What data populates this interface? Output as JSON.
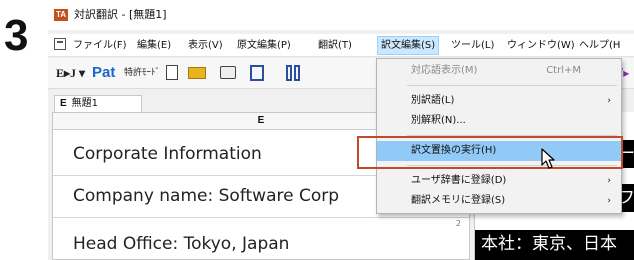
{
  "step_number": "3",
  "window": {
    "app_icon_text": "TA",
    "title": "対訳翻訳 - [無題1]"
  },
  "menubar": {
    "items": [
      "ファイル(F)",
      "編集(E)",
      "表示(V)",
      "原文編集(P)",
      "翻訳(T)",
      "訳文編集(S)",
      "ツール(L)",
      "ウィンドウ(W)",
      "ヘルプ(H"
    ]
  },
  "toolbar": {
    "ej_label": "E▸J ▾",
    "patent_label": "Pat",
    "patent_mode": "特許ﾓｰﾄﾞ"
  },
  "doc_tab": {
    "prefix": "E",
    "name": "無題1"
  },
  "left_pane": {
    "column_header": "E",
    "rows": [
      "Corporate Information",
      "Company name: Software Corp",
      "Head Office: Tokyo, Japan"
    ],
    "row_number": "2"
  },
  "right_pane": {
    "rows": [
      "メー",
      "ソフ",
      "本社：東京、日本"
    ]
  },
  "dropdown": {
    "items": [
      {
        "label": "対応語表示(M)",
        "shortcut": "Ctrl+M",
        "disabled": true
      },
      {
        "label": "別訳語(L)",
        "submenu": true
      },
      {
        "label": "別解釈(N)..."
      },
      {
        "label": "訳文置換の実行(H)",
        "highlighted": true
      },
      {
        "label": "ユーザ辞書に登録(D)",
        "submenu": true
      },
      {
        "label": "翻訳メモリに登録(S)",
        "submenu": true
      }
    ],
    "submenu_arrow": "›"
  },
  "colors": {
    "highlight_box": "#c2492b",
    "menu_highlight": "#91c9f7",
    "active_menu": "#cce8ff"
  }
}
